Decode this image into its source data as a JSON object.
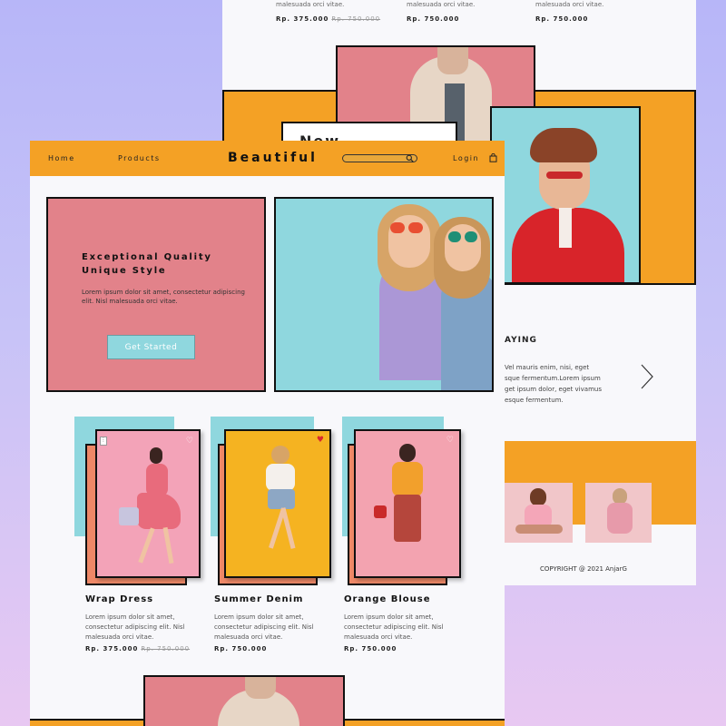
{
  "back_page": {
    "top_products": [
      {
        "desc": "malesuada orci vitae.",
        "price": "Rp. 375.000",
        "old_price": "Rp. 750.000"
      },
      {
        "desc": "malesuada orci vitae.",
        "price": "Rp. 750.000",
        "old_price": ""
      },
      {
        "desc": "malesuada orci vitae.",
        "price": "Rp. 750.000",
        "old_price": ""
      }
    ],
    "new_heading": "New",
    "testimonial_heading": "AYING",
    "testimonial_text": "Vel mauris enim, nisi, eget\nsque fermentum.Lorem ipsum\nget ipsum dolor, eget vivamus\nesque fermentum.",
    "copyright": "COPYRIGHT @ 2021 AnjarG"
  },
  "nav": {
    "home": "Home",
    "products": "Products",
    "brand": "Beautiful",
    "login": "Login",
    "search_placeholder": ""
  },
  "hero": {
    "heading_line1": "Exceptional Quality",
    "heading_line2": "Unique Style",
    "text": "Lorem ipsum dolor sit amet, consectetur adipiscing\nelit. Nisl malesuada orci vitae.",
    "cta": "Get Started"
  },
  "products": [
    {
      "title": "Wrap Dress",
      "desc": "Lorem ipsum dolor sit amet,\nconsectetur adipiscing elit. Nisl\nmalesuada orci vitae.",
      "price": "Rp. 375.000",
      "old_price": "Rp. 750.000",
      "favorited": false
    },
    {
      "title": "Summer Denim",
      "desc": "Lorem ipsum dolor sit amet,\nconsectetur adipiscing elit. Nisl\nmalesuada orci vitae.",
      "price": "Rp. 750.000",
      "old_price": "",
      "favorited": true
    },
    {
      "title": "Orange Blouse",
      "desc": "Lorem ipsum dolor sit amet,\nconsectetur adipiscing elit. Nisl\nmalesuada orci vitae.",
      "price": "Rp. 750.000",
      "old_price": "",
      "favorited": false
    }
  ],
  "colors": {
    "orange": "#f4a125",
    "pink": "#e2828a",
    "blue": "#8fd7de",
    "salmon": "#ee8867",
    "favorite_red": "#d8282e"
  },
  "icons": [
    "search-icon",
    "cart-icon",
    "heart-icon",
    "chevron-right-icon"
  ]
}
